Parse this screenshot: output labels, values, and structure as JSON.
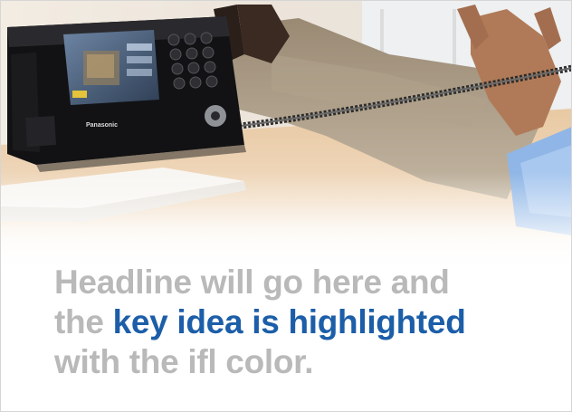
{
  "headline": {
    "line1": "Headline will go here and",
    "line2_prefix": "the ",
    "line2_highlight": "key idea is highlighted",
    "line3": "with the ifl color."
  },
  "phone": {
    "brand": "Panasonic"
  },
  "colors": {
    "headline_gray": "#b9b9b9",
    "highlight_blue": "#1c5ea8",
    "background": "#ffffff"
  },
  "icons": {
    "phone": "desk-phone-icon",
    "photo": "office-desk-photo"
  }
}
